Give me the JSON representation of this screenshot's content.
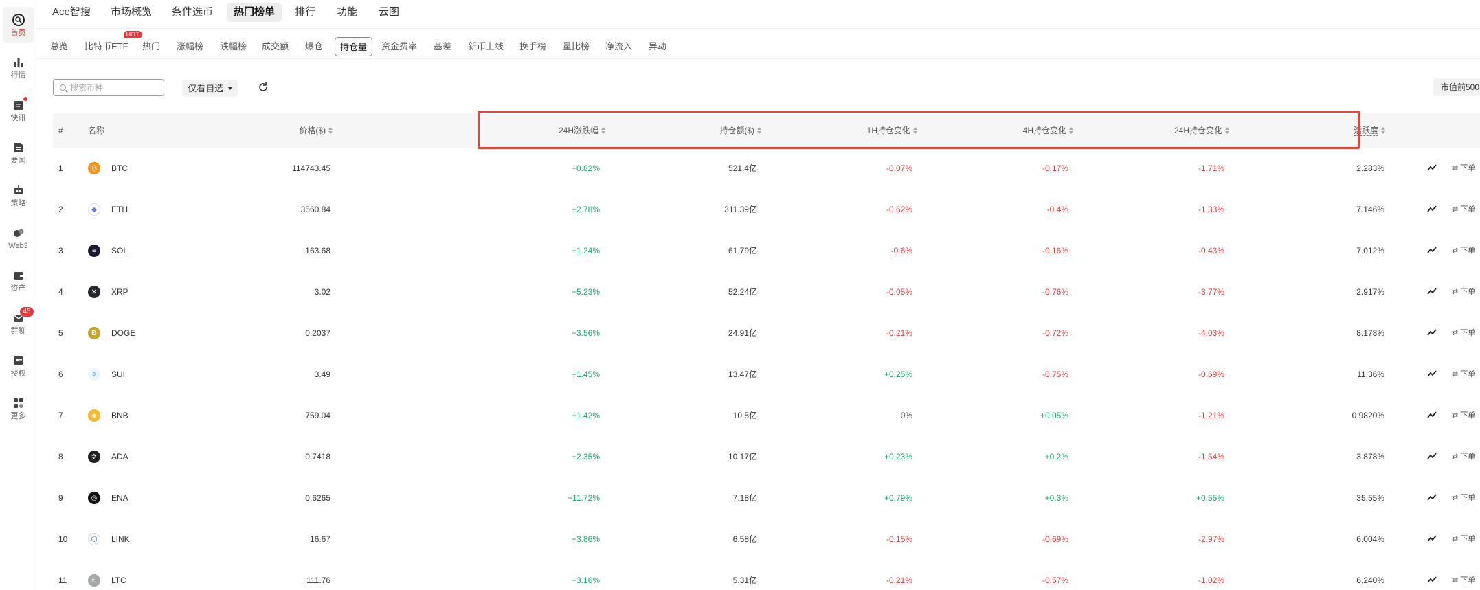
{
  "sidebar": {
    "items": [
      {
        "label": "首页",
        "icon": "home-search-icon",
        "active": true
      },
      {
        "label": "行情",
        "icon": "bar-chart-icon"
      },
      {
        "label": "快讯",
        "icon": "news-icon",
        "dot": true
      },
      {
        "label": "要闻",
        "icon": "article-icon"
      },
      {
        "label": "策略",
        "icon": "robot-icon"
      },
      {
        "label": "Web3",
        "icon": "web3-icon"
      },
      {
        "label": "资产",
        "icon": "wallet-icon"
      },
      {
        "label": "群聊",
        "icon": "chat-icon",
        "badge": "45"
      },
      {
        "label": "授权",
        "icon": "auth-icon"
      },
      {
        "label": "更多",
        "icon": "grid-icon"
      }
    ]
  },
  "topnav": {
    "items": [
      "Ace智搜",
      "市场概览",
      "条件选币",
      "热门榜单",
      "排行",
      "功能",
      "云图"
    ],
    "active_index": 3
  },
  "subtabs": {
    "items": [
      "总览",
      "比特币ETF",
      "热门",
      "涨幅榜",
      "跌幅榜",
      "成交额",
      "爆仓",
      "持仓量",
      "资金费率",
      "基差",
      "新币上线",
      "换手榜",
      "量比榜",
      "净流入",
      "异动"
    ],
    "hot_label": "HOT",
    "active_index": 7
  },
  "toolbar": {
    "search_placeholder": "搜索币种",
    "filter_label": "仅看自选",
    "market_cap_label": "市值前500"
  },
  "table": {
    "headers": {
      "rank": "#",
      "name": "名称",
      "price": "价格($)",
      "change_24h": "24H涨跌幅",
      "oi_amount": "持仓额($)",
      "oi_change_1h": "1H持仓变化",
      "oi_change_4h": "4H持仓变化",
      "oi_change_24h": "24H持仓变化",
      "activity": "活跃度"
    },
    "order_label": "⇄ 下单",
    "rows": [
      {
        "rank": "1",
        "name": "BTC",
        "price": "114743.45",
        "change_24h": "+0.82%",
        "oi_amount": "521.4亿",
        "oi_change_1h": "-0.07%",
        "oi_change_4h": "-0.17%",
        "oi_change_24h": "-1.71%",
        "activity": "2.283%"
      },
      {
        "rank": "2",
        "name": "ETH",
        "price": "3560.84",
        "change_24h": "+2.78%",
        "oi_amount": "311.39亿",
        "oi_change_1h": "-0.62%",
        "oi_change_4h": "-0.4%",
        "oi_change_24h": "-1.33%",
        "activity": "7.146%"
      },
      {
        "rank": "3",
        "name": "SOL",
        "price": "163.68",
        "change_24h": "+1.24%",
        "oi_amount": "61.79亿",
        "oi_change_1h": "-0.6%",
        "oi_change_4h": "-0.16%",
        "oi_change_24h": "-0.43%",
        "activity": "7.012%"
      },
      {
        "rank": "4",
        "name": "XRP",
        "price": "3.02",
        "change_24h": "+5.23%",
        "oi_amount": "52.24亿",
        "oi_change_1h": "-0.05%",
        "oi_change_4h": "-0.76%",
        "oi_change_24h": "-3.77%",
        "activity": "2.917%"
      },
      {
        "rank": "5",
        "name": "DOGE",
        "price": "0.2037",
        "change_24h": "+3.56%",
        "oi_amount": "24.91亿",
        "oi_change_1h": "-0.21%",
        "oi_change_4h": "-0.72%",
        "oi_change_24h": "-4.03%",
        "activity": "8.178%"
      },
      {
        "rank": "6",
        "name": "SUI",
        "price": "3.49",
        "change_24h": "+1.45%",
        "oi_amount": "13.47亿",
        "oi_change_1h": "+0.25%",
        "oi_change_4h": "-0.75%",
        "oi_change_24h": "-0.69%",
        "activity": "11.36%"
      },
      {
        "rank": "7",
        "name": "BNB",
        "price": "759.04",
        "change_24h": "+1.42%",
        "oi_amount": "10.5亿",
        "oi_change_1h": "0%",
        "oi_change_4h": "+0.05%",
        "oi_change_24h": "-1.21%",
        "activity": "0.9820%"
      },
      {
        "rank": "8",
        "name": "ADA",
        "price": "0.7418",
        "change_24h": "+2.35%",
        "oi_amount": "10.17亿",
        "oi_change_1h": "+0.23%",
        "oi_change_4h": "+0.2%",
        "oi_change_24h": "-1.54%",
        "activity": "3.878%"
      },
      {
        "rank": "9",
        "name": "ENA",
        "price": "0.6265",
        "change_24h": "+11.72%",
        "oi_amount": "7.18亿",
        "oi_change_1h": "+0.79%",
        "oi_change_4h": "+0.3%",
        "oi_change_24h": "+0.55%",
        "activity": "35.55%"
      },
      {
        "rank": "10",
        "name": "LINK",
        "price": "16.67",
        "change_24h": "+3.86%",
        "oi_amount": "6.58亿",
        "oi_change_1h": "-0.15%",
        "oi_change_4h": "-0.69%",
        "oi_change_24h": "-2.97%",
        "activity": "6.004%"
      },
      {
        "rank": "11",
        "name": "LTC",
        "price": "111.76",
        "change_24h": "+3.16%",
        "oi_amount": "5.31亿",
        "oi_change_1h": "-0.21%",
        "oi_change_4h": "-0.57%",
        "oi_change_24h": "-1.02%",
        "activity": "6.240%"
      }
    ]
  },
  "coin_colors": {
    "BTC": "#f7931a",
    "ETH": "#ffffff",
    "SOL": "#1a1a2e",
    "XRP": "#23292f",
    "DOGE": "#c2a633",
    "SUI": "#e8f4fc",
    "BNB": "#f3ba2f",
    "ADA": "#222222",
    "ENA": "#111111",
    "LINK": "#ffffff",
    "LTC": "#a6a9aa"
  },
  "colors": {
    "up": "#1aaa6a",
    "down": "#e5393b",
    "highlight_border": "#e8443a"
  }
}
